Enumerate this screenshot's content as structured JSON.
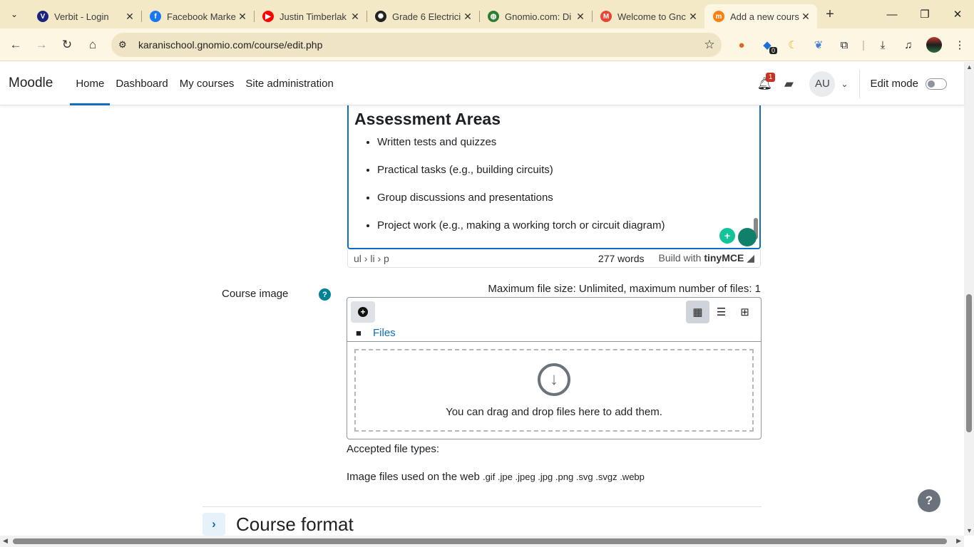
{
  "browser": {
    "tabs": [
      {
        "title": "Verbit - Login",
        "icon": "verbit-icon",
        "color": "#1a237e",
        "glyph": "V"
      },
      {
        "title": "Facebook Marke",
        "icon": "facebook-icon",
        "color": "#1877f2",
        "glyph": "f"
      },
      {
        "title": "Justin Timberlak",
        "icon": "youtube-icon",
        "color": "#ff0000",
        "glyph": "▶"
      },
      {
        "title": "Grade 6 Electrici",
        "icon": "openai-icon",
        "color": "#222222",
        "glyph": "✺"
      },
      {
        "title": "Gnomio.com: Di",
        "icon": "globe-icon",
        "color": "#2e7d32",
        "glyph": "◍"
      },
      {
        "title": "Welcome to Gnc",
        "icon": "gmail-icon",
        "color": "#ea4335",
        "glyph": "M"
      },
      {
        "title": "Add a new cours",
        "icon": "moodle-icon",
        "color": "#f98012",
        "glyph": "m"
      }
    ],
    "url": "karanischool.gnomio.com/course/edit.php",
    "extension_badge": "0"
  },
  "navbar": {
    "brand": "Moodle",
    "links": [
      "Home",
      "Dashboard",
      "My courses",
      "Site administration"
    ],
    "notification_count": "1",
    "user_initials": "AU",
    "edit_mode_label": "Edit mode"
  },
  "editor": {
    "heading": "Assessment Areas",
    "items": [
      "Written tests and quizzes",
      "Practical tasks (e.g., building circuits)",
      "Group discussions and presentations",
      "Project work (e.g., making a working torch or circuit diagram)"
    ],
    "path": "ul › li › p",
    "word_count": "277 words",
    "build_with": "Build with",
    "tinymce": "tinyMCE"
  },
  "course_image": {
    "label": "Course image",
    "max_size": "Maximum file size: Unlimited, maximum number of files: 1",
    "files_link": "Files",
    "drop_text": "You can drag and drop files here to add them.",
    "accepted_label": "Accepted file types:",
    "types_label": "Image files used on the web",
    "extensions": ".gif .jpe .jpeg .jpg .png .svg .svgz .webp"
  },
  "section": {
    "title": "Course format"
  },
  "help_float": "?"
}
